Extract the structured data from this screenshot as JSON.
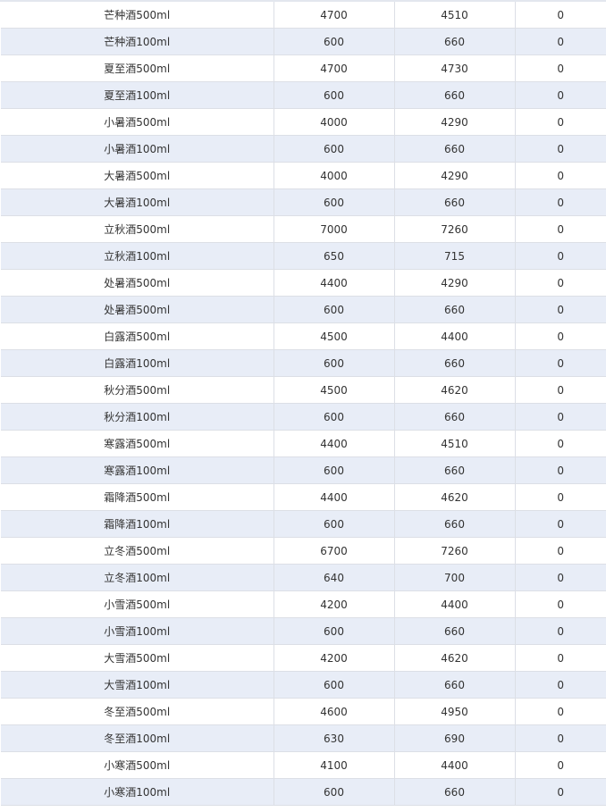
{
  "table": {
    "rows": [
      {
        "name": "芒种酒500ml",
        "col2": "4700",
        "col3": "4510",
        "col4": "0"
      },
      {
        "name": "芒种酒100ml",
        "col2": "600",
        "col3": "660",
        "col4": "0"
      },
      {
        "name": "夏至酒500ml",
        "col2": "4700",
        "col3": "4730",
        "col4": "0"
      },
      {
        "name": "夏至酒100ml",
        "col2": "600",
        "col3": "660",
        "col4": "0"
      },
      {
        "name": "小暑酒500ml",
        "col2": "4000",
        "col3": "4290",
        "col4": "0"
      },
      {
        "name": "小暑酒100ml",
        "col2": "600",
        "col3": "660",
        "col4": "0"
      },
      {
        "name": "大暑酒500ml",
        "col2": "4000",
        "col3": "4290",
        "col4": "0"
      },
      {
        "name": "大暑酒100ml",
        "col2": "600",
        "col3": "660",
        "col4": "0"
      },
      {
        "name": "立秋酒500ml",
        "col2": "7000",
        "col3": "7260",
        "col4": "0"
      },
      {
        "name": "立秋酒100ml",
        "col2": "650",
        "col3": "715",
        "col4": "0"
      },
      {
        "name": "处暑酒500ml",
        "col2": "4400",
        "col3": "4290",
        "col4": "0"
      },
      {
        "name": "处暑酒500ml",
        "col2": "600",
        "col3": "660",
        "col4": "0"
      },
      {
        "name": "白露酒500ml",
        "col2": "4500",
        "col3": "4400",
        "col4": "0"
      },
      {
        "name": "白露酒100ml",
        "col2": "600",
        "col3": "660",
        "col4": "0"
      },
      {
        "name": "秋分酒500ml",
        "col2": "4500",
        "col3": "4620",
        "col4": "0"
      },
      {
        "name": "秋分酒100ml",
        "col2": "600",
        "col3": "660",
        "col4": "0"
      },
      {
        "name": "寒露酒500ml",
        "col2": "4400",
        "col3": "4510",
        "col4": "0"
      },
      {
        "name": "寒露酒100ml",
        "col2": "600",
        "col3": "660",
        "col4": "0"
      },
      {
        "name": "霜降酒500ml",
        "col2": "4400",
        "col3": "4620",
        "col4": "0"
      },
      {
        "name": "霜降酒100ml",
        "col2": "600",
        "col3": "660",
        "col4": "0"
      },
      {
        "name": "立冬酒500ml",
        "col2": "6700",
        "col3": "7260",
        "col4": "0"
      },
      {
        "name": "立冬酒100ml",
        "col2": "640",
        "col3": "700",
        "col4": "0"
      },
      {
        "name": "小雪酒500ml",
        "col2": "4200",
        "col3": "4400",
        "col4": "0"
      },
      {
        "name": "小雪酒100ml",
        "col2": "600",
        "col3": "660",
        "col4": "0"
      },
      {
        "name": "大雪酒500ml",
        "col2": "4200",
        "col3": "4620",
        "col4": "0"
      },
      {
        "name": "大雪酒100ml",
        "col2": "600",
        "col3": "660",
        "col4": "0"
      },
      {
        "name": "冬至酒500ml",
        "col2": "4600",
        "col3": "4950",
        "col4": "0"
      },
      {
        "name": "冬至酒100ml",
        "col2": "630",
        "col3": "690",
        "col4": "0"
      },
      {
        "name": "小寒酒500ml",
        "col2": "4100",
        "col3": "4400",
        "col4": "0"
      },
      {
        "name": "小寒酒100ml",
        "col2": "600",
        "col3": "660",
        "col4": "0"
      }
    ]
  }
}
